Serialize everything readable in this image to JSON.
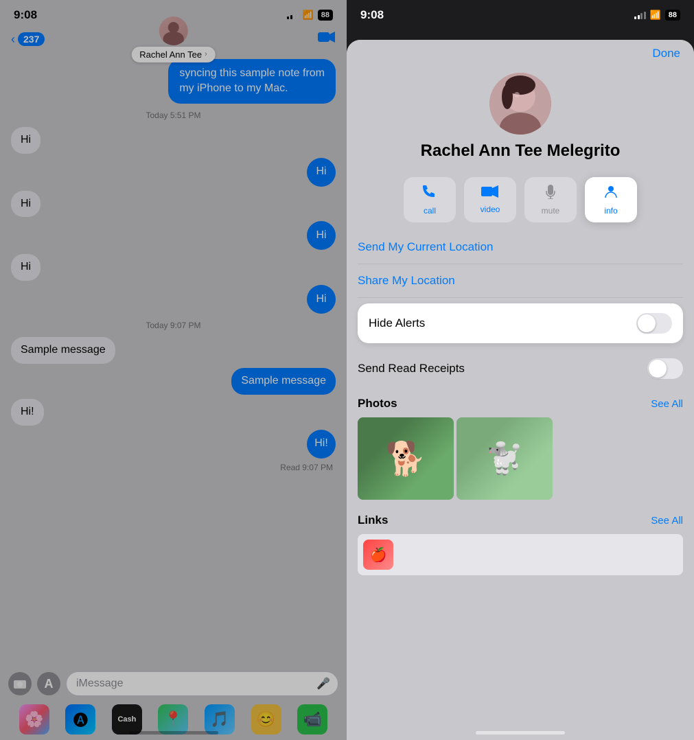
{
  "left": {
    "status_time": "9:08",
    "battery": "88",
    "back_count": "237",
    "contact_name_bubble": "Rachel Ann Tee",
    "messages": [
      {
        "id": 1,
        "text": "syncing this sample note from my iPhone to my Mac.",
        "type": "outgoing",
        "timestamp": null
      },
      {
        "id": 2,
        "text": "Today 5:51 PM",
        "type": "timestamp"
      },
      {
        "id": 3,
        "text": "Hi",
        "type": "incoming"
      },
      {
        "id": 4,
        "text": "Hi",
        "type": "outgoing_small"
      },
      {
        "id": 5,
        "text": "Hi",
        "type": "incoming"
      },
      {
        "id": 6,
        "text": "Hi",
        "type": "outgoing_small"
      },
      {
        "id": 7,
        "text": "Hi",
        "type": "incoming"
      },
      {
        "id": 8,
        "text": "Hi",
        "type": "outgoing_small"
      },
      {
        "id": 9,
        "text": "Today 9:07 PM",
        "type": "timestamp"
      },
      {
        "id": 10,
        "text": "Sample message",
        "type": "incoming"
      },
      {
        "id": 11,
        "text": "Sample message",
        "type": "outgoing"
      },
      {
        "id": 12,
        "text": "Hi!",
        "type": "incoming"
      },
      {
        "id": 13,
        "text": "Hi!",
        "type": "outgoing_small"
      },
      {
        "id": 14,
        "text": "Read 9:07 PM",
        "type": "read_label"
      }
    ],
    "input_placeholder": "iMessage",
    "dock_icons": [
      "Photos",
      "App Store",
      "Apple Cash",
      "Find My",
      "SoundCloud",
      "Memoji",
      "FaceTime"
    ]
  },
  "right": {
    "status_time": "9:08",
    "battery": "88",
    "done_label": "Done",
    "contact_full_name": "Rachel Ann Tee Melegrito",
    "actions": [
      {
        "id": "call",
        "label": "call",
        "icon": "📞"
      },
      {
        "id": "video",
        "label": "video",
        "icon": "📹"
      },
      {
        "id": "mute",
        "label": "mute",
        "icon": "🔕"
      },
      {
        "id": "info",
        "label": "info",
        "icon": "👤"
      }
    ],
    "options": [
      {
        "id": "send_location",
        "label": "Send My Current Location"
      },
      {
        "id": "share_location",
        "label": "Share My Location"
      }
    ],
    "hide_alerts": {
      "label": "Hide Alerts",
      "enabled": false
    },
    "send_read_receipts": {
      "label": "Send Read Receipts",
      "enabled": false
    },
    "photos_section": {
      "title": "Photos",
      "see_all": "See All"
    },
    "links_section": {
      "title": "Links",
      "see_all": "See All"
    }
  }
}
